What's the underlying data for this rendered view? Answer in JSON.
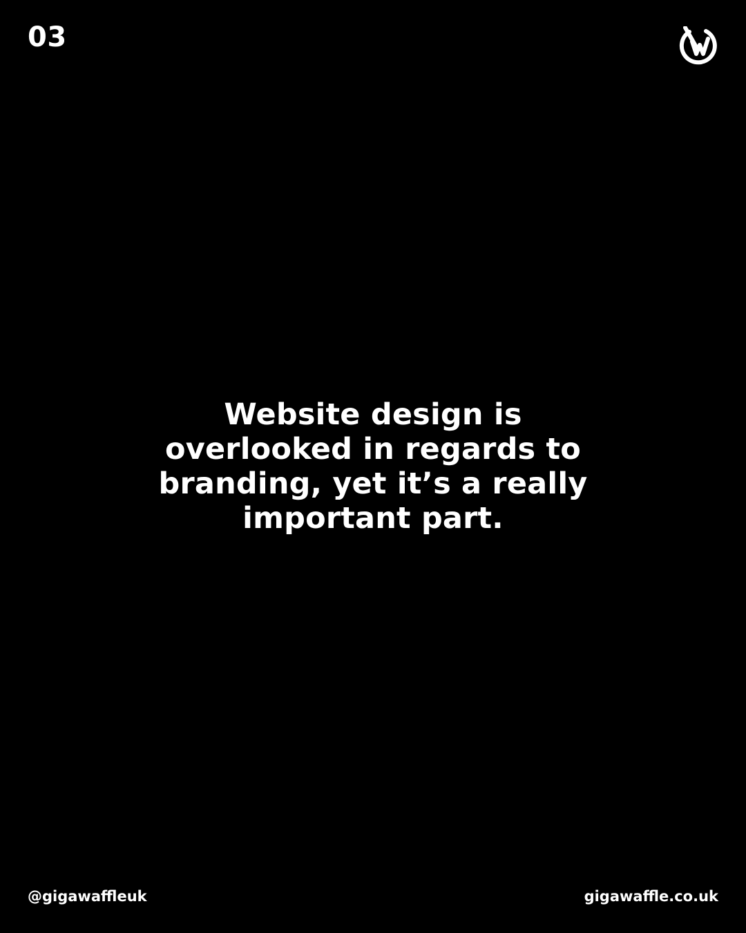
{
  "slide": {
    "number": "03"
  },
  "brand": {
    "logo_icon": "gigawaffle-w-logo-icon",
    "handle": "@gigawaffleuk",
    "website": "gigawaffle.co.uk"
  },
  "content": {
    "headline_lines": [
      "Website design is",
      "overlooked in regards to",
      "branding, yet it’s a really",
      "important part."
    ]
  },
  "colors": {
    "background": "#000000",
    "text": "#ffffff"
  }
}
